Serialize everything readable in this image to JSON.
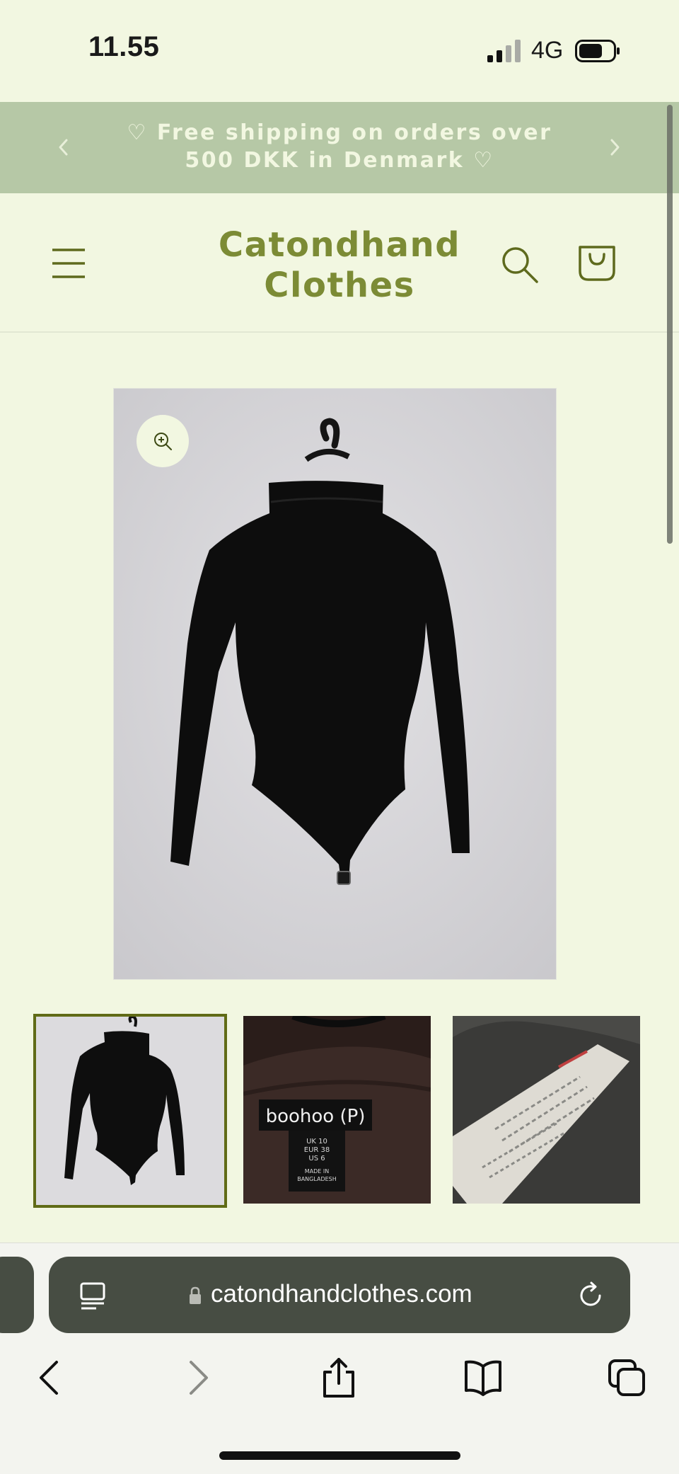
{
  "status_bar": {
    "time": "11.55",
    "network": "4G"
  },
  "announcement": {
    "text": "♡ Free shipping on orders over 500 DKK in Denmark ♡"
  },
  "header": {
    "logo_line1": "Catondhand",
    "logo_line2": "Clothes"
  },
  "gallery": {
    "selected_index": 0,
    "thumbnail_count": 3
  },
  "label_image": {
    "brand": "boohoo (P)",
    "size_lines": [
      "UK 10",
      "EUR 38",
      "US 6"
    ],
    "made_in": [
      "MADE IN",
      "BANGLADESH"
    ]
  },
  "browser": {
    "url": "catondhandclothes.com"
  },
  "colors": {
    "background": "#f2f7e1",
    "announcement_bg": "#b6c8a6",
    "brand_green": "#7c8b35",
    "thumb_border": "#606b16",
    "url_pill": "#474d43"
  }
}
